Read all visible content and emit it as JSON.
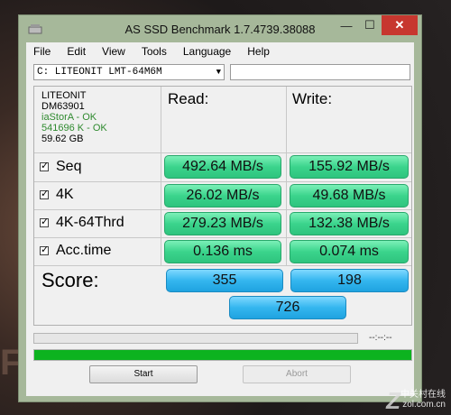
{
  "window": {
    "title": "AS SSD Benchmark 1.7.4739.38088"
  },
  "menu": [
    "File",
    "Edit",
    "View",
    "Tools",
    "Language",
    "Help"
  ],
  "drive_select": {
    "value": "C: LITEONIT LMT-64M6M"
  },
  "device": {
    "name": "LITEONIT",
    "model": "DM63901",
    "driver": "iaStorA - OK",
    "alignment": "541696 K - OK",
    "size": "59.62 GB"
  },
  "headers": {
    "read": "Read:",
    "write": "Write:"
  },
  "rows": [
    {
      "label": "Seq",
      "read": "492.64 MB/s",
      "write": "155.92 MB/s"
    },
    {
      "label": "4K",
      "read": "26.02 MB/s",
      "write": "49.68 MB/s"
    },
    {
      "label": "4K-64Thrd",
      "read": "279.23 MB/s",
      "write": "132.38 MB/s"
    },
    {
      "label": "Acc.time",
      "read": "0.136 ms",
      "write": "0.074 ms"
    }
  ],
  "score": {
    "label": "Score:",
    "read": "355",
    "write": "198",
    "total": "726"
  },
  "progress": {
    "timer": "--:--:--",
    "current": 0,
    "total": 1.0
  },
  "buttons": {
    "start": "Start",
    "abort": "Abort"
  },
  "watermark": {
    "line1": "中关村在线",
    "line2": "zol.com.cn"
  },
  "colors": {
    "result": "#3bd48c",
    "score": "#34b6ef",
    "progress": "#0cb31f",
    "close": "#c7372f"
  }
}
